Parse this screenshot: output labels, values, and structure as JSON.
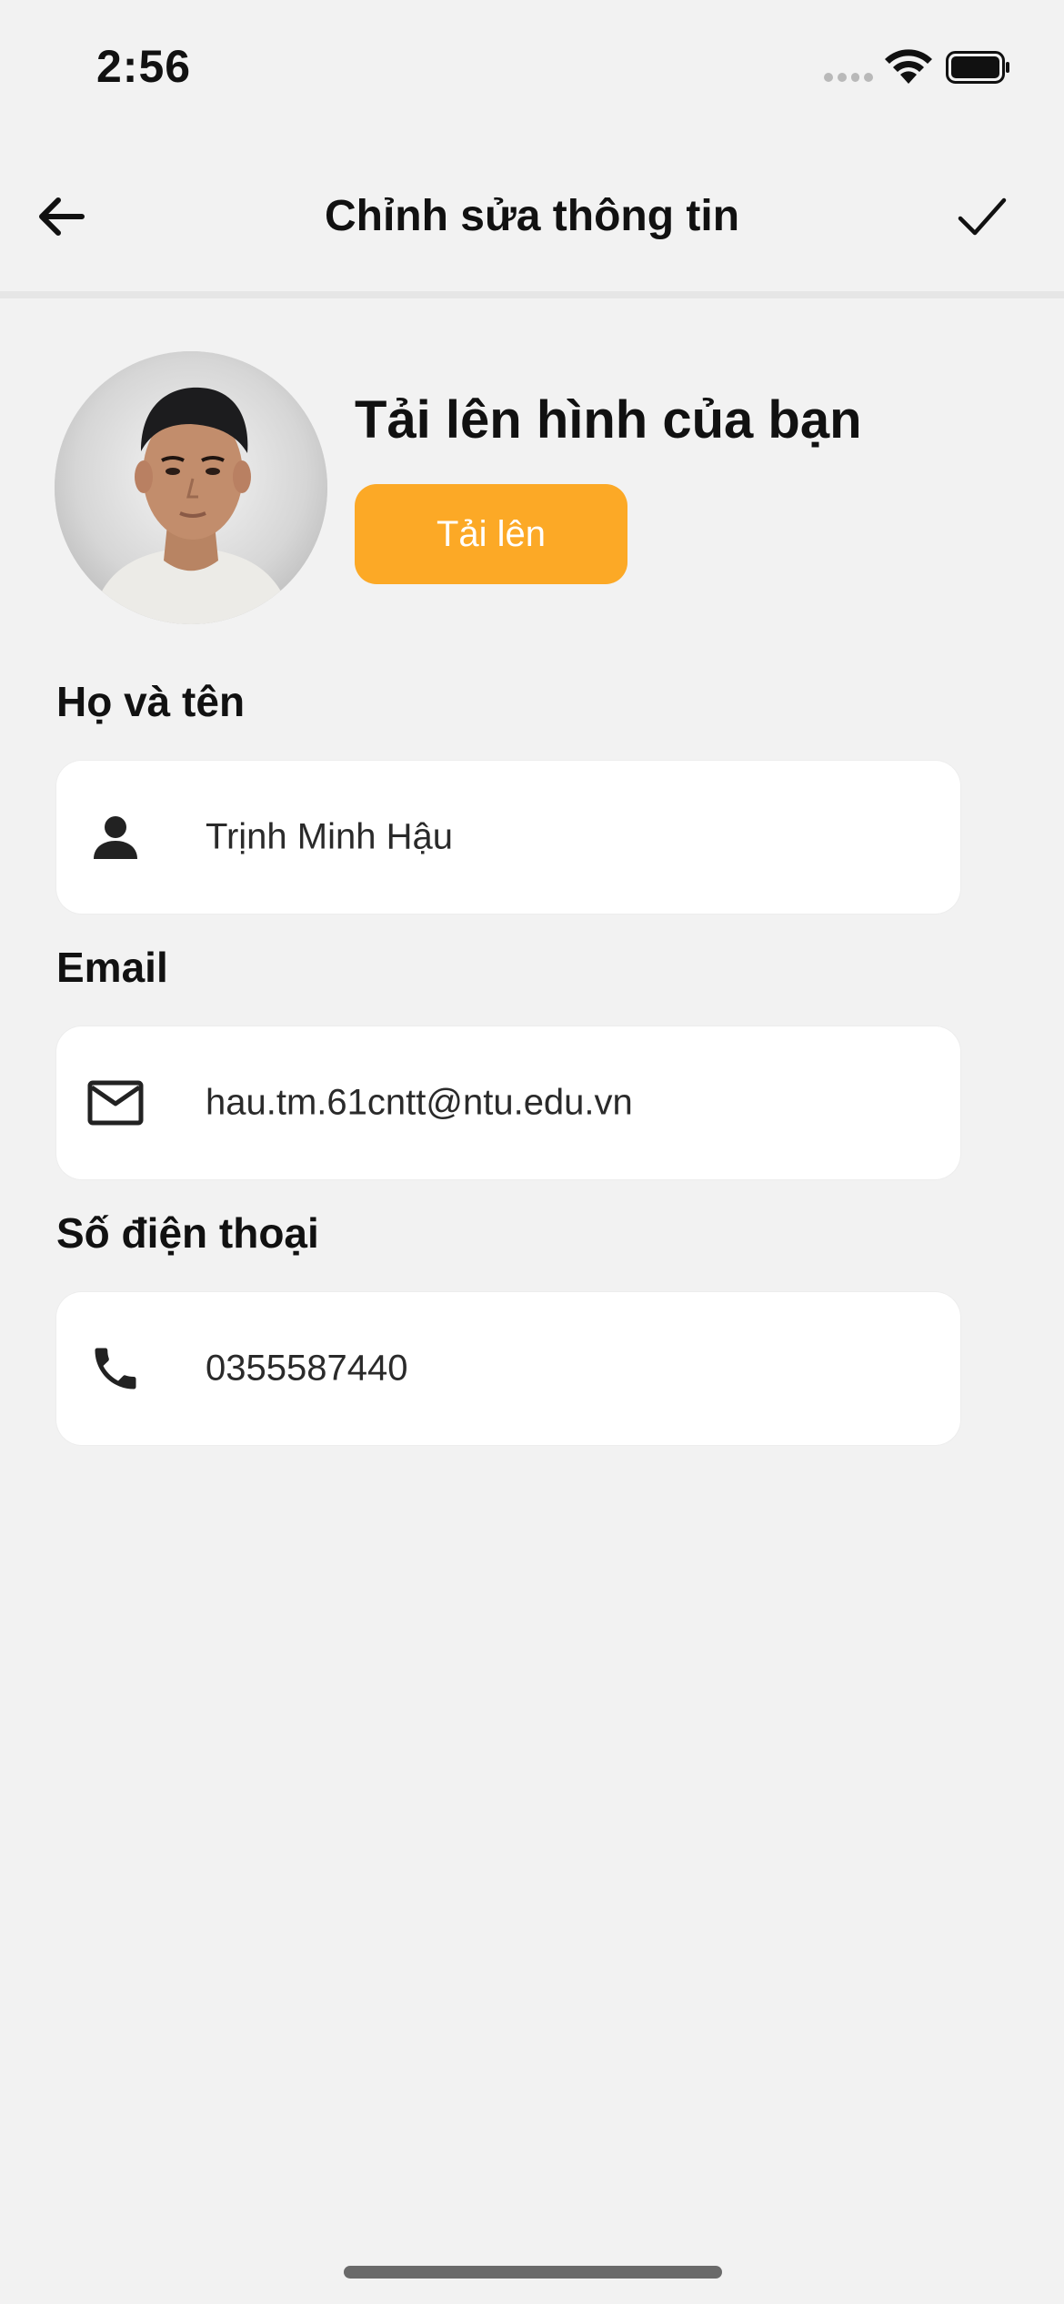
{
  "status_bar": {
    "time": "2:56",
    "wifi_icon": "wifi-icon",
    "battery_icon": "battery-icon"
  },
  "nav": {
    "title": "Chỉnh sửa thông tin",
    "back_icon": "arrow-left-icon",
    "confirm_icon": "checkmark-icon"
  },
  "profile": {
    "avatar_icon": "profile-photo",
    "upload_heading": "Tải lên hình của bạn",
    "upload_button_label": "Tải lên",
    "accent_color": "#fca926"
  },
  "fields": {
    "name": {
      "label": "Họ và tên",
      "value": "Trịnh Minh Hậu",
      "icon": "person-icon"
    },
    "email": {
      "label": "Email",
      "value": "hau.tm.61cntt@ntu.edu.vn",
      "icon": "mail-icon"
    },
    "phone": {
      "label": "Số điện thoại",
      "value": "0355587440",
      "icon": "phone-icon"
    }
  }
}
